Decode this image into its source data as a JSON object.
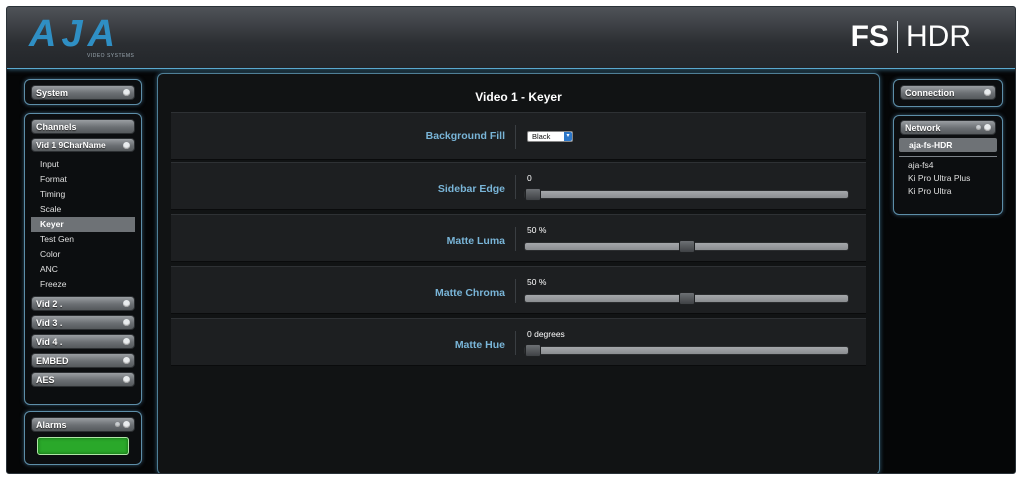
{
  "header": {
    "logo_text": "AJA",
    "logo_subtitle": "VIDEO SYSTEMS",
    "product_prefix": "FS",
    "product_suffix": "HDR"
  },
  "sidebar": {
    "system_label": "System",
    "channels_label": "Channels",
    "current_channel": "Vid 1 9CharName",
    "menu": [
      "Input",
      "Format",
      "Timing",
      "Scale",
      "Keyer",
      "Test Gen",
      "Color",
      "ANC",
      "Freeze"
    ],
    "active_menu": "Keyer",
    "groups": [
      "Vid 2 .",
      "Vid 3 .",
      "Vid 4 .",
      "EMBED",
      "AES"
    ],
    "alarms_label": "Alarms"
  },
  "right": {
    "connection_label": "Connection",
    "network_label": "Network",
    "selected_device": "aja-fs-HDR",
    "devices": [
      "aja-fs4",
      "Ki Pro Ultra Plus",
      "Ki Pro Ultra"
    ]
  },
  "main": {
    "title": "Video 1 - Keyer",
    "background_fill": {
      "label": "Background Fill",
      "value": "Black"
    },
    "sidebar_edge": {
      "label": "Sidebar Edge",
      "value_text": "0",
      "fraction": 0.0
    },
    "matte_luma": {
      "label": "Matte Luma",
      "value_text": "50 %",
      "fraction": 0.5
    },
    "matte_chroma": {
      "label": "Matte Chroma",
      "value_text": "50 %",
      "fraction": 0.5
    },
    "matte_hue": {
      "label": "Matte Hue",
      "value_text": "0 degrees",
      "fraction": 0.0
    }
  },
  "colors": {
    "accent_blue": "#79b5d8",
    "panel_border": "#5d8ea8",
    "alarm_ok": "#2aa82a"
  }
}
